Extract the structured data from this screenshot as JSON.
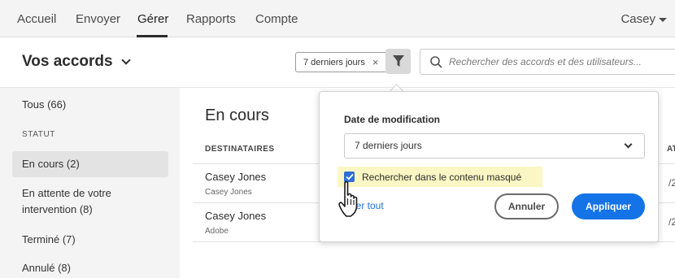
{
  "nav": {
    "items": [
      {
        "label": "Accueil"
      },
      {
        "label": "Envoyer"
      },
      {
        "label": "Gérer"
      },
      {
        "label": "Rapports"
      },
      {
        "label": "Compte"
      }
    ],
    "active": "Gérer",
    "user": "Casey"
  },
  "header": {
    "title": "Vos accords",
    "filter_chip": "7 derniers jours",
    "search_placeholder": "Rechercher des accords et des utilisateurs..."
  },
  "sidebar": {
    "all": "Tous (66)",
    "section": "STATUT",
    "items": [
      {
        "label": "En cours (2)"
      },
      {
        "label": "En attente de votre"
      },
      {
        "label": "intervention (8)"
      },
      {
        "label": "Terminé (7)"
      },
      {
        "label": "Annulé (8)"
      }
    ]
  },
  "main": {
    "title": "En cours",
    "column_header": "DESTINATAIRES",
    "column_header_right": "AT",
    "rows": [
      {
        "name": "Casey Jones",
        "sub": "Casey Jones",
        "right": "/2"
      },
      {
        "name": "Casey Jones",
        "sub": "Adobe",
        "right": "/2"
      }
    ]
  },
  "popover": {
    "label": "Date de modification",
    "select_value": "7 derniers jours",
    "checkbox_label": "Rechercher dans le contenu masqué",
    "checkbox_checked": true,
    "reset_link": "ier tout",
    "cancel": "Annuler",
    "apply": "Appliquer"
  },
  "colors": {
    "accent": "#1473e6",
    "highlight": "#fbf7c4",
    "sidebar_bg": "#f4f4f4"
  }
}
